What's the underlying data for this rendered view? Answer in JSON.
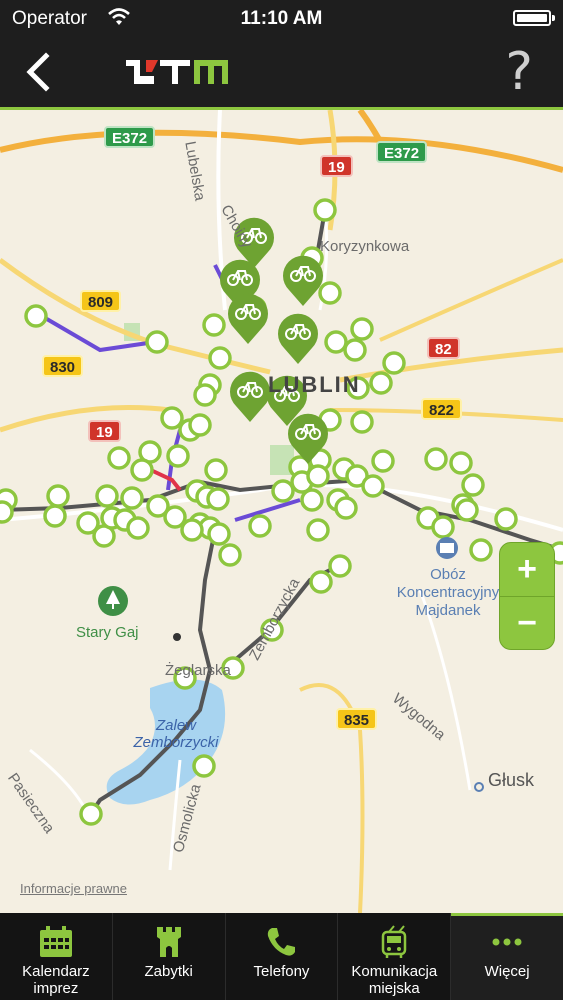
{
  "status_bar": {
    "carrier": "Operator",
    "time": "11:10 AM"
  },
  "nav": {
    "help_label": "?"
  },
  "map": {
    "shields": [
      {
        "label": "E372",
        "color": "green"
      },
      {
        "label": "E372",
        "color": "green"
      },
      {
        "label": "19",
        "color": "red"
      },
      {
        "label": "809",
        "color": "yellow"
      },
      {
        "label": "830",
        "color": "yellow"
      },
      {
        "label": "82",
        "color": "red"
      },
      {
        "label": "822",
        "color": "yellow"
      },
      {
        "label": "19",
        "color": "red"
      },
      {
        "label": "835",
        "color": "yellow"
      }
    ],
    "streets": [
      "Lubelska",
      "Choiny",
      "Koryzynkowa",
      "Zemborzycka",
      "Wygodna",
      "Pasieczna",
      "Osmolicka",
      "Żeglarska"
    ],
    "city_label": "LUBLIN",
    "poi": "Obóz Koncentracyjny Majdanek",
    "park": "Stary Gaj",
    "lake": "Zalew Zemborzycki",
    "village": "Głusk",
    "legal_link": "Informacje prawne",
    "zoom_in": "+",
    "zoom_out": "−"
  },
  "tabs": [
    {
      "label": "Kalendarz imprez",
      "icon": "calendar-icon",
      "active": false
    },
    {
      "label": "Zabytki",
      "icon": "castle-tower-icon",
      "active": false
    },
    {
      "label": "Telefony",
      "icon": "phone-icon",
      "active": false
    },
    {
      "label": "Komunikacja miejska",
      "icon": "trolleybus-icon",
      "active": false
    },
    {
      "label": "Więcej",
      "icon": "more-dots-icon",
      "active": true
    }
  ],
  "colors": {
    "accent": "#8dc63f",
    "bar_bg": "#1e1e1e",
    "map_bg": "#f4efe2"
  }
}
